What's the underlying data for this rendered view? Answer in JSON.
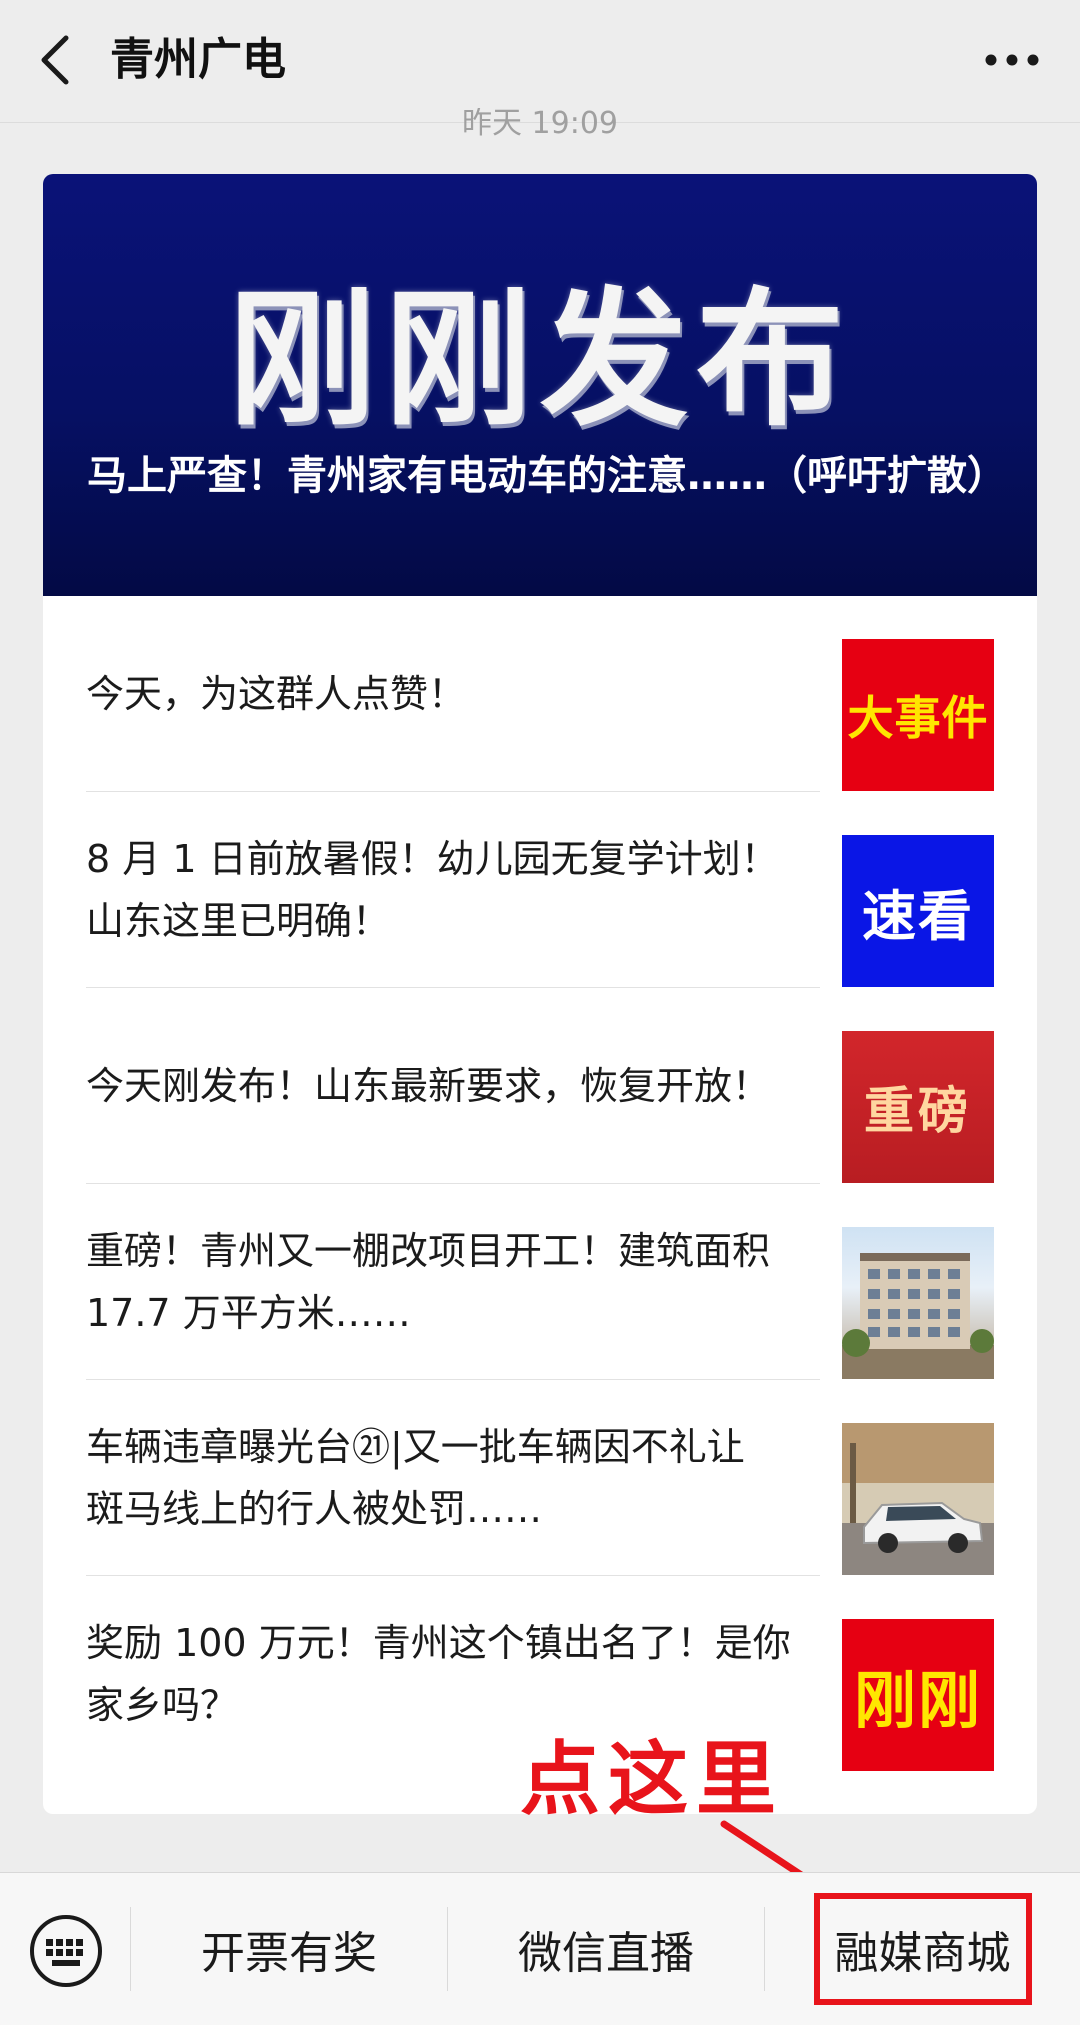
{
  "header": {
    "title": "青州广电",
    "back_icon": "chevron-left-icon",
    "more_icon": "more-dots-icon"
  },
  "timestamp": "昨天 19:09",
  "banner": {
    "headline": "刚刚发布",
    "caption": "马上严查！青州家有电动车的注意……（呼吁扩散）",
    "bg_color": "#061064"
  },
  "articles": [
    {
      "title_lines": [
        "今天，为这群人点赞！"
      ],
      "thumb_text": "大事件"
    },
    {
      "title_lines": [
        "8 月 1 日前放暑假！幼儿园无复学计划！",
        "山东这里已明确！"
      ],
      "thumb_text": "速看"
    },
    {
      "title_lines": [
        "今天刚发布！山东最新要求，恢复开放！"
      ],
      "thumb_text": "重磅"
    },
    {
      "title_lines": [
        "重磅！青州又一棚改项目开工！建筑面积",
        "17.7 万平方米……"
      ],
      "thumb_text": ""
    },
    {
      "title_lines": [
        "车辆违章曝光台㉑|又一批车辆因不礼让",
        "斑马线上的行人被处罚……"
      ],
      "thumb_text": ""
    },
    {
      "title_lines": [
        "奖励 100 万元！青州这个镇出名了！是你",
        "家乡吗？"
      ],
      "thumb_text": "刚刚"
    }
  ],
  "annotation": {
    "text": "点这里",
    "color": "#e8141b"
  },
  "menu": {
    "keyboard_icon": "keyboard-icon",
    "items": [
      "开票有奖",
      "微信直播",
      "融媒商城"
    ]
  }
}
